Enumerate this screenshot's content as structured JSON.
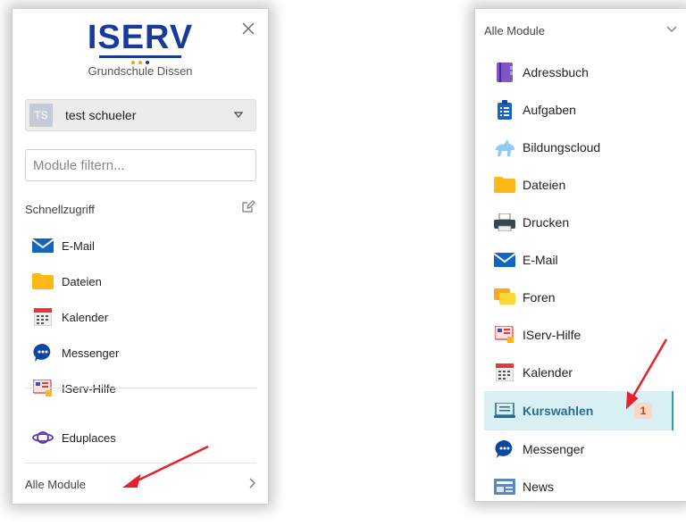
{
  "left": {
    "logo": "ISERV",
    "school": "Grundschule Dissen",
    "user": {
      "initials": "TS",
      "name": "test schueler"
    },
    "filter": {
      "placeholder": "Module filtern...",
      "value": ""
    },
    "section_title": "Schnellzugriff",
    "quick_items": [
      {
        "label": "E-Mail",
        "icon": "mail-icon"
      },
      {
        "label": "Dateien",
        "icon": "folder-icon"
      },
      {
        "label": "Kalender",
        "icon": "calendar-icon"
      },
      {
        "label": "Messenger",
        "icon": "messenger-icon"
      },
      {
        "label": "IServ-Hilfe",
        "icon": "help-icon"
      }
    ],
    "extra_item": {
      "label": "Eduplaces",
      "icon": "eduplaces-icon"
    },
    "all_modules": "Alle Module"
  },
  "right": {
    "header": "Alle Module",
    "items": [
      {
        "label": "Adressbuch",
        "icon": "address-book-icon"
      },
      {
        "label": "Aufgaben",
        "icon": "tasks-icon"
      },
      {
        "label": "Bildungscloud",
        "icon": "bildungscloud-icon"
      },
      {
        "label": "Dateien",
        "icon": "folder-icon"
      },
      {
        "label": "Drucken",
        "icon": "printer-icon"
      },
      {
        "label": "E-Mail",
        "icon": "mail-icon"
      },
      {
        "label": "Foren",
        "icon": "forum-icon"
      },
      {
        "label": "IServ-Hilfe",
        "icon": "help-icon"
      },
      {
        "label": "Kalender",
        "icon": "calendar-icon"
      },
      {
        "label": "Kurswahlen",
        "icon": "course-selection-icon",
        "badge": "1",
        "active": true
      },
      {
        "label": "Messenger",
        "icon": "messenger-icon"
      },
      {
        "label": "News",
        "icon": "news-icon"
      }
    ]
  },
  "colors": {
    "brand": "#1a3a9a",
    "active_bg": "#d8f0f3",
    "active_text": "#2a6e8a",
    "badge_bg": "#fad8c8",
    "annotation_arrow": "#e8202a"
  }
}
